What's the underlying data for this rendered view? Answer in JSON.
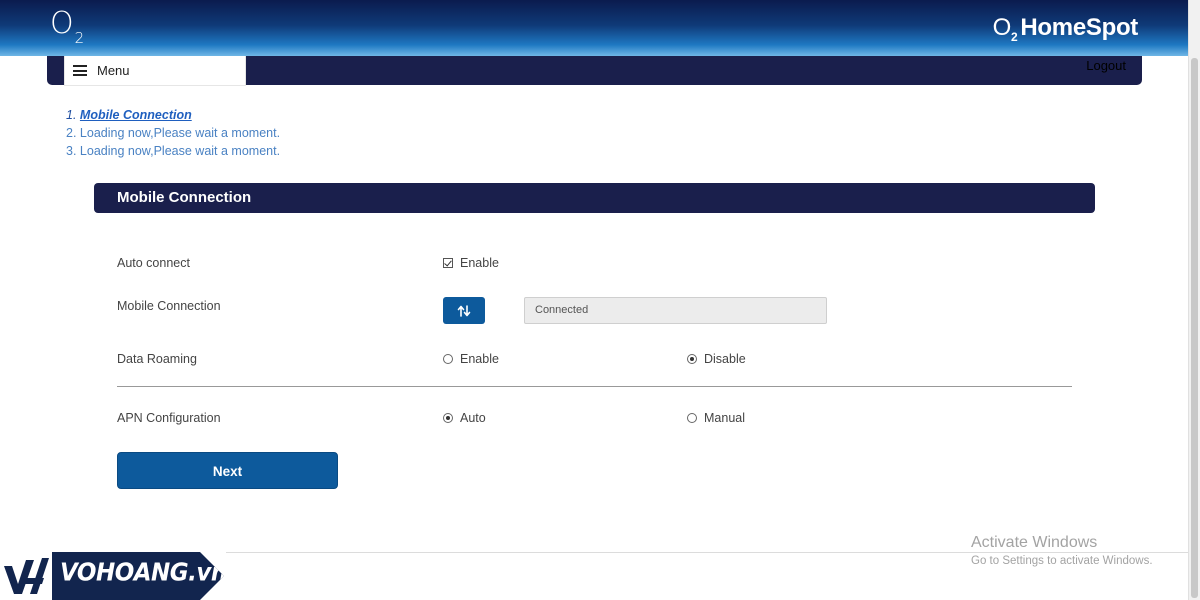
{
  "header": {
    "logo_left": "O",
    "logo_left_sub": "2",
    "logo_right_o": "O",
    "logo_right_sub": "2",
    "logo_right_text": "HomeSpot"
  },
  "navbar": {
    "menu_label": "Menu",
    "logout_label": "Logout"
  },
  "steps": [
    {
      "number": "1.",
      "label": "Mobile Connection",
      "active": true
    },
    {
      "number": "2.",
      "label": "Loading now,Please wait a moment.",
      "active": false
    },
    {
      "number": "3.",
      "label": "Loading now,Please wait a moment.",
      "active": false
    }
  ],
  "section": {
    "title": "Mobile Connection"
  },
  "form": {
    "auto_connect": {
      "label": "Auto connect",
      "option": "Enable",
      "checked": true
    },
    "mobile_connection": {
      "label": "Mobile Connection",
      "button_icon": "swap-vertical-icon",
      "status": "Connected"
    },
    "data_roaming": {
      "label": "Data Roaming",
      "options": [
        "Enable",
        "Disable"
      ],
      "selected": "Disable"
    },
    "apn_configuration": {
      "label": "APN Configuration",
      "options": [
        "Auto",
        "Manual"
      ],
      "selected": "Auto"
    }
  },
  "actions": {
    "next_label": "Next"
  },
  "watermark": {
    "title": "Activate Windows",
    "subtitle": "Go to Settings to activate Windows."
  },
  "brand": {
    "text": "VOHOANG.vn"
  },
  "colors": {
    "navy": "#1a1f4c",
    "button_blue": "#0d5a9c",
    "link_blue": "#4a82c3"
  }
}
